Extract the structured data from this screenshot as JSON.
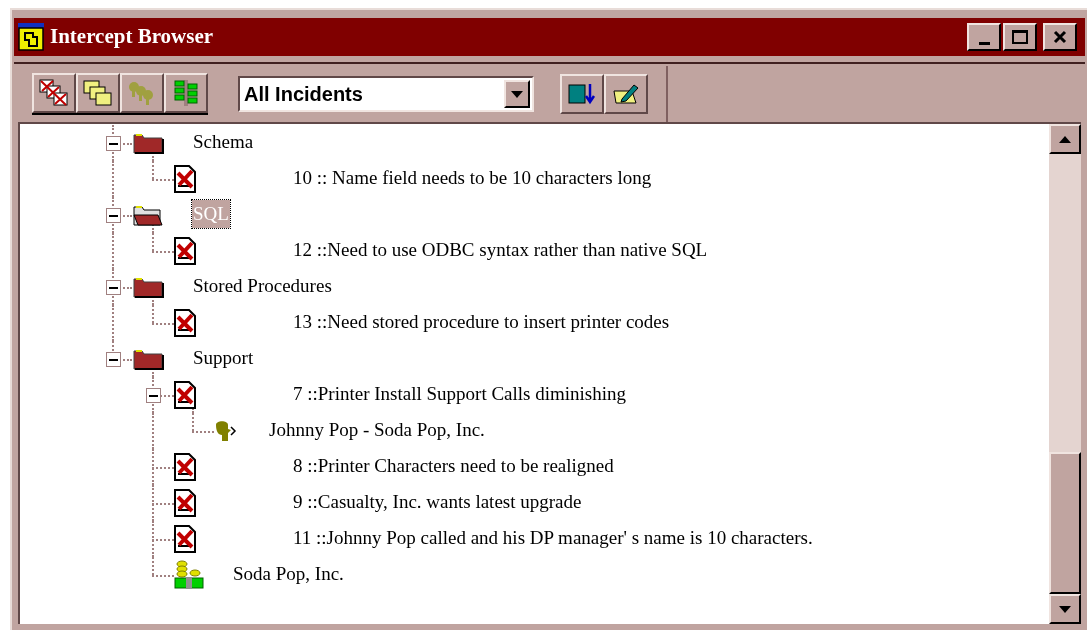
{
  "window": {
    "title": "Intercept Browser"
  },
  "toolbar": {
    "filter": {
      "value": "All Incidents"
    }
  },
  "tree": [
    {
      "kind": "folder",
      "label": "Schema",
      "expanded": true,
      "selected": false,
      "children": [
        {
          "kind": "incident",
          "label": "10 :: Name field needs to be 10 characters long",
          "selected": false
        }
      ]
    },
    {
      "kind": "folder",
      "label": "SQL",
      "expanded": true,
      "selected": true,
      "children": [
        {
          "kind": "incident",
          "label": "12 ::Need to use ODBC syntax rather than native SQL",
          "selected": false
        }
      ]
    },
    {
      "kind": "folder",
      "label": "Stored Procedures",
      "expanded": true,
      "selected": false,
      "children": [
        {
          "kind": "incident",
          "label": "13 ::Need stored procedure to insert printer codes",
          "selected": false
        }
      ]
    },
    {
      "kind": "folder",
      "label": "Support",
      "expanded": true,
      "selected": false,
      "children": [
        {
          "kind": "incident",
          "label": "7 ::Printer Install Support Calls diminishing",
          "expanded": true,
          "selected": false,
          "children": [
            {
              "kind": "contact",
              "label": "Johnny Pop - Soda Pop, Inc.",
              "selected": false
            }
          ]
        },
        {
          "kind": "incident",
          "label": "8 ::Printer Characters need to be realigned",
          "selected": false
        },
        {
          "kind": "incident",
          "label": "9 ::Casualty, Inc. wants latest upgrade",
          "selected": false
        },
        {
          "kind": "incident",
          "label": "11 ::Johnny Pop called and his DP manager' s name is 10 characters.",
          "selected": false
        },
        {
          "kind": "company",
          "label": "Soda Pop, Inc.",
          "selected": false
        }
      ]
    }
  ]
}
